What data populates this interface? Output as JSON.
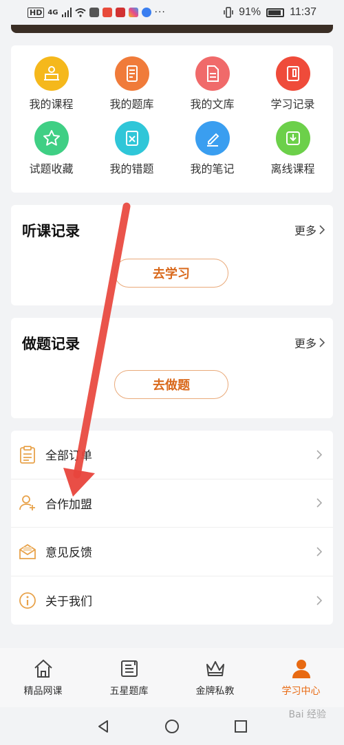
{
  "statusbar": {
    "battery": "91%",
    "time": "11:37",
    "net": "4G"
  },
  "grid": [
    {
      "label": "我的课程",
      "icon": "course-icon",
      "color": "#f5b81c"
    },
    {
      "label": "我的题库",
      "icon": "question-bank-icon",
      "color": "#f07b3a"
    },
    {
      "label": "我的文库",
      "icon": "library-doc-icon",
      "color": "#f06a6a"
    },
    {
      "label": "学习记录",
      "icon": "study-record-icon",
      "color": "#ef4b3a"
    },
    {
      "label": "试题收藏",
      "icon": "favorite-star-icon",
      "color": "#3fcf84"
    },
    {
      "label": "我的错题",
      "icon": "wrong-question-icon",
      "color": "#2fc6d8"
    },
    {
      "label": "我的笔记",
      "icon": "notes-pen-icon",
      "color": "#3a9ef0"
    },
    {
      "label": "离线课程",
      "icon": "download-icon",
      "color": "#6cd04a"
    }
  ],
  "listen": {
    "title": "听课记录",
    "more": "更多",
    "button": "去学习"
  },
  "practice": {
    "title": "做题记录",
    "more": "更多",
    "button": "去做题"
  },
  "menu": [
    {
      "label": "全部订单",
      "icon": "order-clipboard-icon"
    },
    {
      "label": "合作加盟",
      "icon": "add-user-icon"
    },
    {
      "label": "意见反馈",
      "icon": "feedback-mail-icon"
    },
    {
      "label": "关于我们",
      "icon": "info-icon"
    }
  ],
  "nav": [
    {
      "label": "精品网课",
      "icon": "home-icon",
      "active": false
    },
    {
      "label": "五星题库",
      "icon": "book-icon",
      "active": false
    },
    {
      "label": "金牌私教",
      "icon": "crown-icon",
      "active": false
    },
    {
      "label": "学习中心",
      "icon": "person-icon",
      "active": true
    }
  ],
  "watermark": "Bai 经验",
  "colors": {
    "accent": "#e86a12",
    "button_border": "#e9a979",
    "arrow": "#e8453c"
  }
}
